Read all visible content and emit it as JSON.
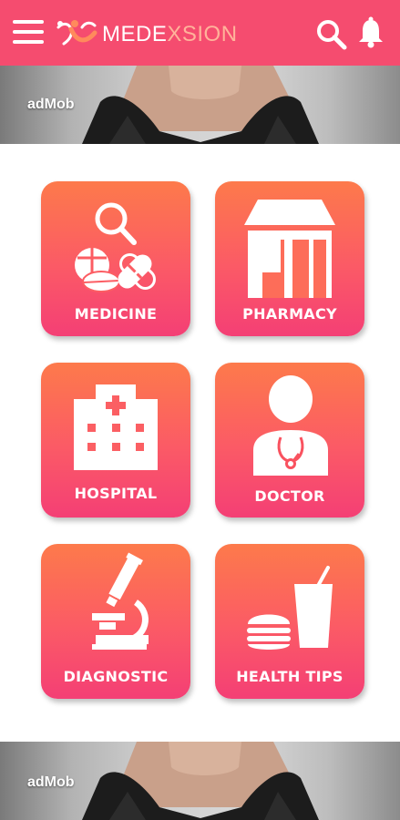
{
  "app": {
    "brand_part1": "MEDE",
    "brand_part2": "XSION",
    "brand_color": "#f54c6f",
    "icons": [
      "menu-icon",
      "logo-icon",
      "search-icon",
      "bell-icon"
    ]
  },
  "ads": {
    "top_label": "adMob",
    "bottom_label": "adMob"
  },
  "tiles": [
    {
      "label": "MEDICINE",
      "icon": "medicine-icon"
    },
    {
      "label": "PHARMACY",
      "icon": "pharmacy-icon"
    },
    {
      "label": "HOSPITAL",
      "icon": "hospital-icon"
    },
    {
      "label": "DOCTOR",
      "icon": "doctor-icon"
    },
    {
      "label": "DIAGNOSTIC",
      "icon": "microscope-icon"
    },
    {
      "label": "HEALTH TIPS",
      "icon": "food-drink-icon"
    }
  ],
  "colors": {
    "tile_top": "#fd7a4b",
    "tile_bottom": "#f43f75"
  }
}
